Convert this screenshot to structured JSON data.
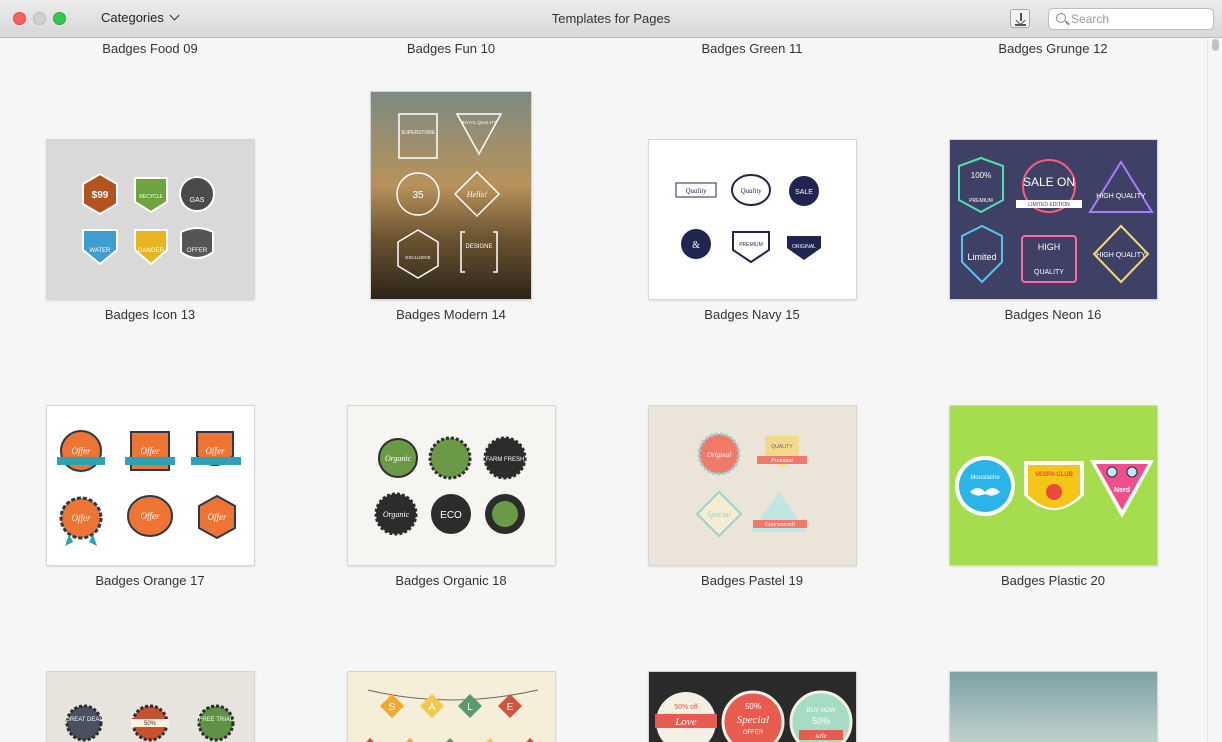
{
  "window": {
    "title": "Templates for Pages",
    "categories_label": "Categories"
  },
  "search": {
    "placeholder": "Search"
  },
  "top_row": [
    "Badges Food 09",
    "Badges Fun 10",
    "Badges Green 11",
    "Badges Grunge 12"
  ],
  "items": [
    {
      "name": "Badges Icon 13",
      "texts": [
        "$99",
        "RECYCLE",
        "GAS",
        "WATER",
        "DANGER",
        "OFFER"
      ]
    },
    {
      "name": "Badges Modern 14",
      "texts": [
        "SUPERSTORE",
        "ROYAL QUALITY",
        "35",
        "Hello!",
        "EXCLUSIVE",
        "DESIGNE"
      ]
    },
    {
      "name": "Badges Navy 15",
      "texts": [
        "Quality",
        "Quality",
        "SALE",
        "&",
        "PREMIUM",
        "ORIGINAL"
      ]
    },
    {
      "name": "Badges Neon 16",
      "texts": [
        "100%",
        "PREMIUM",
        "SALE ON",
        "LIMITED EDITION",
        "HIGH QUALITY",
        "Limited",
        "HIGH",
        "QUALITY",
        "HIGH QUALITY"
      ]
    },
    {
      "name": "Badges Orange 17",
      "texts": [
        "Offer",
        "Offer",
        "Offer",
        "Offer",
        "Offer",
        "Offer"
      ]
    },
    {
      "name": "Badges Organic 18",
      "texts": [
        "Organic",
        "",
        "FARM FRESH",
        "Organic",
        "ECO",
        ""
      ]
    },
    {
      "name": "Badges Pastel 19",
      "texts": [
        "Original",
        "QUALITY",
        "Premium",
        "Special",
        "Guaranteed!"
      ]
    },
    {
      "name": "Badges Plastic 20",
      "texts": [
        "Moustache",
        "VESPA CLUB",
        "Nerd"
      ]
    },
    {
      "name": "",
      "texts": [
        "GREAT DEAL",
        "50%",
        "FREE TRIAL"
      ]
    },
    {
      "name": "",
      "texts": [
        "S",
        "A",
        "L",
        "E"
      ]
    },
    {
      "name": "",
      "texts": [
        "50% off",
        "Love",
        "50%",
        "Special",
        "OFFER",
        "BUY NOW",
        "50%",
        "sale"
      ]
    },
    {
      "name": "",
      "texts": []
    }
  ],
  "colors": {
    "close": "#fc605c",
    "minimize": "#d0d0d0",
    "maximize": "#34c84a",
    "window_bg": "#f6f6f6"
  }
}
